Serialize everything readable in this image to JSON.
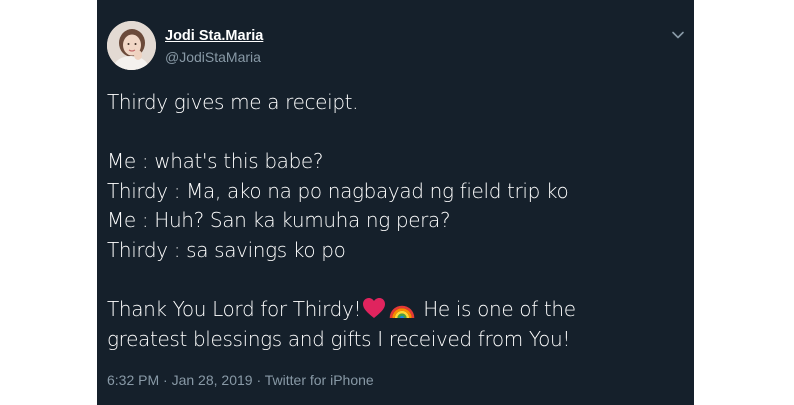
{
  "tweet": {
    "author_name": "Jodi Sta.Maria",
    "author_handle": "@JodiStaMaria",
    "lines": [
      "Thirdy gives me a receipt.",
      "Me : what's this babe?",
      "Thirdy : Ma, ako na po nagbayad ng field trip ko",
      "Me : Huh? San ka kumuha ng pera?",
      "Thirdy : sa savings ko po",
      "Thank You Lord for Thirdy!",
      "He is one of the",
      "greatest blessings and gifts I received from You!"
    ],
    "time": "6:32 PM",
    "date": "Jan 28, 2019",
    "source": "Twitter for iPhone",
    "separator": "·"
  },
  "icons": {
    "dropdown": "chevron-down-icon",
    "heart": "red-heart-emoji",
    "rainbow": "rainbow-emoji",
    "avatar": "profile-photo"
  },
  "colors": {
    "background": "#15202b",
    "text": "#ffffff",
    "secondary": "#8899a6",
    "heart": "#e0245e"
  }
}
